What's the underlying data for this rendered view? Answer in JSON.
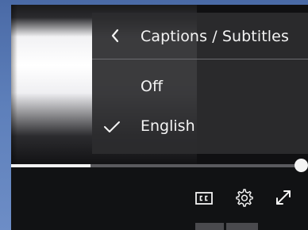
{
  "caption_menu": {
    "title": "Captions / Subtitles",
    "back_icon": "chevron-left-icon",
    "items": [
      {
        "label": "Off",
        "selected": false
      },
      {
        "label": "English",
        "selected": true
      }
    ]
  },
  "playback": {
    "progress_fraction": 0.27
  },
  "controls": {
    "captions_icon": "closed-captions-icon",
    "settings_icon": "gear-icon",
    "fullscreen_icon": "fullscreen-icon"
  },
  "colors": {
    "menu_background": "#2c2c2e",
    "text": "#f4f4f4",
    "progress_fill": "#f2f2f2",
    "progress_track": "#5a5a5e"
  }
}
